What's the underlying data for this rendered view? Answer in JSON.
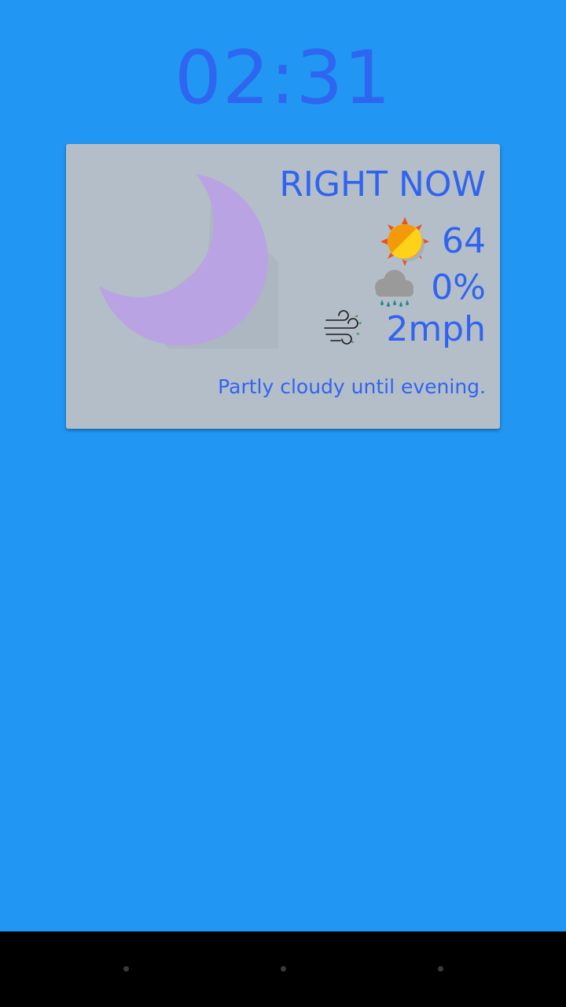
{
  "clock": {
    "time": "02:31"
  },
  "weather_card": {
    "title": "RIGHT NOW",
    "condition_icon": "partly-cloudy-night-moon-icon",
    "temperature": "64",
    "temperature_icon": "partly-sunny-icon",
    "precipitation": "0%",
    "precipitation_icon": "rain-cloud-icon",
    "wind": "2mph",
    "wind_icon": "wind-icon",
    "summary": "Partly cloudy until evening."
  },
  "navigation_bar": {
    "items": [
      "back-button",
      "home-button",
      "recents-button"
    ]
  },
  "colors": {
    "background": "#2196F3",
    "card": "#B4BEC9",
    "text_accent": "#3064F0",
    "moon": "#B9A3E3",
    "navbar": "#000000"
  }
}
